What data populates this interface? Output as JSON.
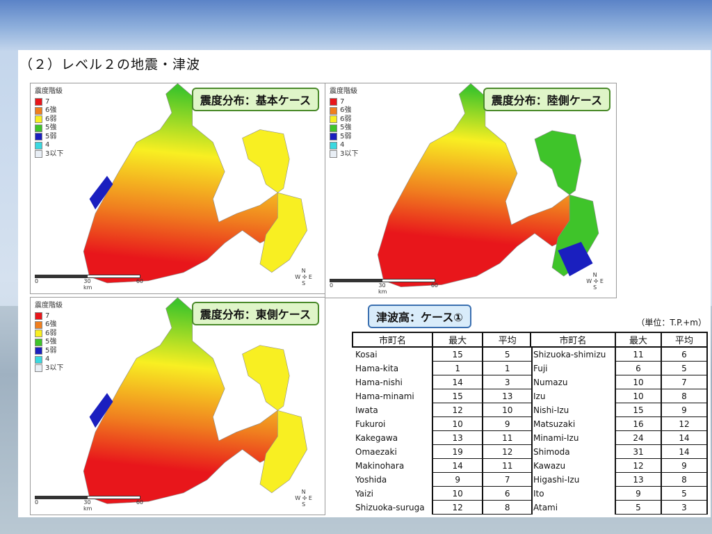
{
  "heading": "（２）レベル２の地震・津波",
  "legend": {
    "title": "震度階級",
    "items": [
      {
        "label": "7",
        "color": "#e8161b"
      },
      {
        "label": "6強",
        "color": "#f07f1f"
      },
      {
        "label": "6弱",
        "color": "#f8ef22"
      },
      {
        "label": "5強",
        "color": "#3fc42a"
      },
      {
        "label": "5弱",
        "color": "#1a1fbf"
      },
      {
        "label": "4",
        "color": "#3ad8e0"
      },
      {
        "label": "3以下",
        "color": "#e8eef5"
      }
    ]
  },
  "maps": [
    {
      "title": "震度分布：基本ケース"
    },
    {
      "title": "震度分布：陸側ケース"
    },
    {
      "title": "震度分布：東側ケース"
    }
  ],
  "scale": {
    "t0": "0",
    "t30": "30",
    "t60": "60",
    "unit": "km"
  },
  "compass": {
    "n": "N",
    "s": "S",
    "e": "E",
    "w": "W"
  },
  "tsunami": {
    "title": "津波高：ケース①",
    "unit": "（単位：T.P.+m）",
    "headers": {
      "city": "市町名",
      "max": "最大",
      "avg": "平均"
    },
    "left": [
      {
        "city": "Kosai",
        "max": "15",
        "avg": "5"
      },
      {
        "city": "Hama-kita",
        "max": "1",
        "avg": "1"
      },
      {
        "city": "Hama-nishi",
        "max": "14",
        "avg": "3"
      },
      {
        "city": "Hama-minami",
        "max": "15",
        "avg": "13"
      },
      {
        "city": "Iwata",
        "max": "12",
        "avg": "10"
      },
      {
        "city": "Fukuroi",
        "max": "10",
        "avg": "9"
      },
      {
        "city": "Kakegawa",
        "max": "13",
        "avg": "11"
      },
      {
        "city": "Omaezaki",
        "max": "19",
        "avg": "12"
      },
      {
        "city": "Makinohara",
        "max": "14",
        "avg": "11"
      },
      {
        "city": "Yoshida",
        "max": "9",
        "avg": "7"
      },
      {
        "city": "Yaizi",
        "max": "10",
        "avg": "6"
      },
      {
        "city": "Shizuoka-suruga",
        "max": "12",
        "avg": "8"
      }
    ],
    "right": [
      {
        "city": "Shizuoka-shimizu",
        "max": "11",
        "avg": "6"
      },
      {
        "city": "Fuji",
        "max": "6",
        "avg": "5"
      },
      {
        "city": "Numazu",
        "max": "10",
        "avg": "7"
      },
      {
        "city": "Izu",
        "max": "10",
        "avg": "8"
      },
      {
        "city": "Nishi-Izu",
        "max": "15",
        "avg": "9"
      },
      {
        "city": "Matsuzaki",
        "max": "16",
        "avg": "12"
      },
      {
        "city": "Minami-Izu",
        "max": "24",
        "avg": "14"
      },
      {
        "city": "Shimoda",
        "max": "31",
        "avg": "14"
      },
      {
        "city": "Kawazu",
        "max": "12",
        "avg": "9"
      },
      {
        "city": "Higashi-Izu",
        "max": "13",
        "avg": "8"
      },
      {
        "city": "Ito",
        "max": "9",
        "avg": "5"
      },
      {
        "city": "Atami",
        "max": "5",
        "avg": "3"
      }
    ]
  }
}
